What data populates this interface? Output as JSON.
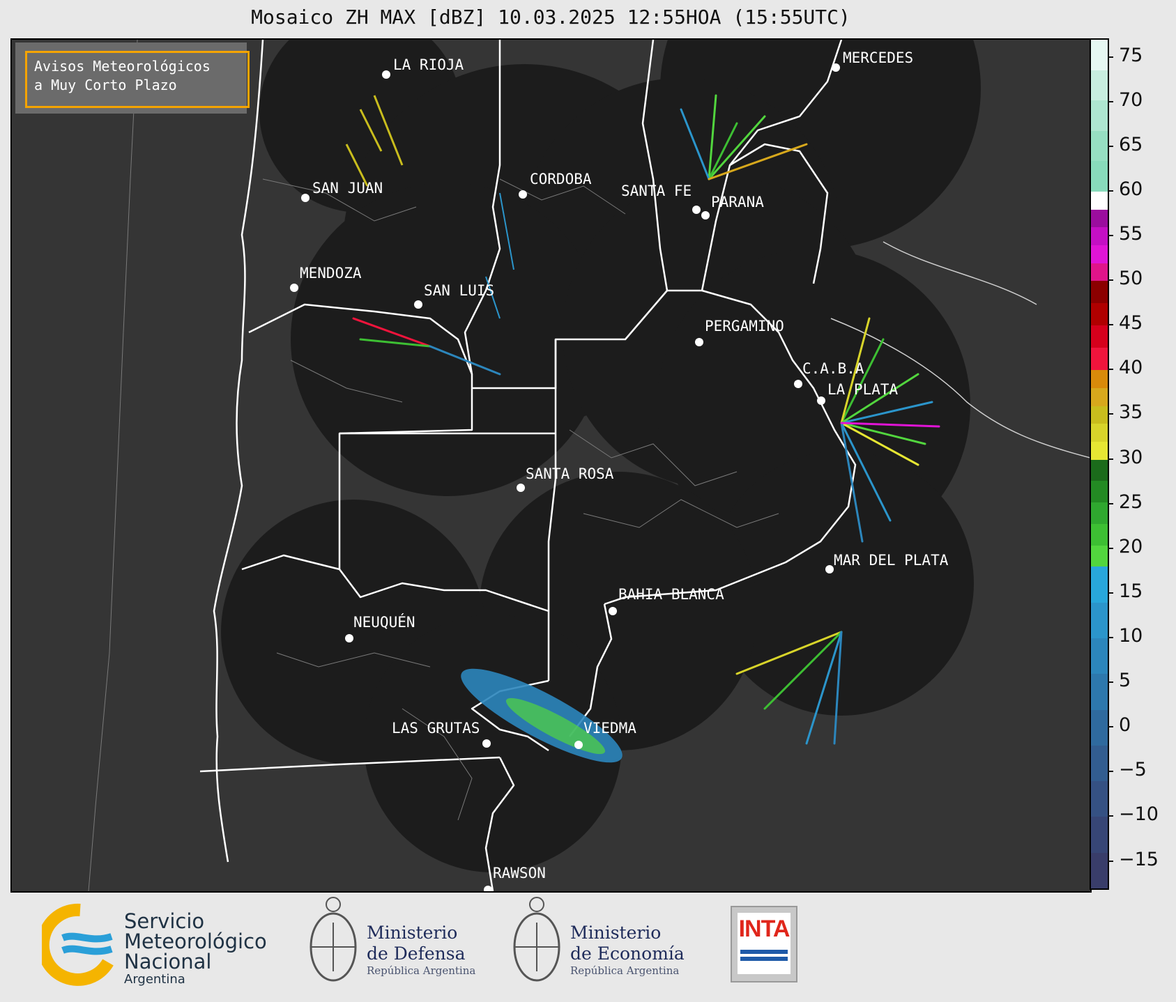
{
  "title": "Mosaico ZH MAX [dBZ] 10.03.2025 12:55HOA (15:55UTC)",
  "notice": {
    "line1": "Avisos Meteorológicos",
    "line2": "a Muy Corto Plazo"
  },
  "cities": [
    {
      "id": "la-rioja",
      "name": "LA RIOJA"
    },
    {
      "id": "mercedes",
      "name": "MERCEDES"
    },
    {
      "id": "san-juan",
      "name": "SAN JUAN"
    },
    {
      "id": "cordoba",
      "name": "CORDOBA"
    },
    {
      "id": "santa-fe",
      "name": "SANTA FE"
    },
    {
      "id": "parana",
      "name": "PARANA"
    },
    {
      "id": "mendoza",
      "name": "MENDOZA"
    },
    {
      "id": "san-luis",
      "name": "SAN LUIS"
    },
    {
      "id": "pergamino",
      "name": "PERGAMINO"
    },
    {
      "id": "caba",
      "name": "C.A.B.A"
    },
    {
      "id": "la-plata",
      "name": "LA PLATA"
    },
    {
      "id": "santa-rosa",
      "name": "SANTA ROSA"
    },
    {
      "id": "mar-del-plata",
      "name": "MAR DEL PLATA"
    },
    {
      "id": "bahia-blanca",
      "name": "BAHIA BLANCA"
    },
    {
      "id": "neuquen",
      "name": "NEUQUÉN"
    },
    {
      "id": "las-grutas",
      "name": "LAS GRUTAS"
    },
    {
      "id": "viedma",
      "name": "VIEDMA"
    },
    {
      "id": "rawson",
      "name": "RAWSON"
    }
  ],
  "colorbar": {
    "unit": "dBZ",
    "min": -18,
    "max": 77,
    "ticks": [
      75,
      70,
      65,
      60,
      55,
      50,
      45,
      40,
      35,
      30,
      25,
      20,
      15,
      10,
      5,
      0,
      -5,
      -10,
      -15
    ],
    "tick_labels": [
      "75",
      "70",
      "65",
      "60",
      "55",
      "50",
      "45",
      "40",
      "35",
      "30",
      "25",
      "20",
      "15",
      "10",
      "5",
      "0",
      "−5",
      "−10",
      "−15"
    ],
    "bands": [
      {
        "from": 60,
        "to": 77,
        "colors": [
          "#e6f7f2",
          "#c8eedf",
          "#aee6d0",
          "#96dfc2",
          "#88dbbb"
        ]
      },
      {
        "from": 58,
        "to": 60,
        "colors": [
          "#ffffff"
        ]
      },
      {
        "from": 50,
        "to": 58,
        "colors": [
          "#9b0d9e",
          "#c40fc4",
          "#e014d6",
          "#e0148a"
        ]
      },
      {
        "from": 40,
        "to": 50,
        "colors": [
          "#8b0000",
          "#b00000",
          "#d6001c",
          "#f0143c"
        ]
      },
      {
        "from": 30,
        "to": 40,
        "colors": [
          "#d98a0a",
          "#d7a81c",
          "#c9bd1d",
          "#d8d42a",
          "#e6e633"
        ]
      },
      {
        "from": 18,
        "to": 30,
        "colors": [
          "#1b6b1b",
          "#238a23",
          "#2fa82f",
          "#3dbf33",
          "#52d63e"
        ]
      },
      {
        "from": -18,
        "to": 18,
        "colors": [
          "#28a7db",
          "#2b95cb",
          "#2c86bc",
          "#2d78ad",
          "#2f6a9e",
          "#325d90",
          "#355183",
          "#374676",
          "#393d6a"
        ]
      }
    ]
  },
  "logos": {
    "smn": {
      "line1": "Servicio",
      "line2": "Meteorológico",
      "line3": "Nacional",
      "sub": "Argentina"
    },
    "defensa": {
      "line1": "Ministerio",
      "line2": "de Defensa",
      "sub": "República Argentina"
    },
    "economia": {
      "line1": "Ministerio",
      "line2": "de Economía",
      "sub": "República Argentina"
    },
    "inta": {
      "text": "INTA"
    }
  }
}
